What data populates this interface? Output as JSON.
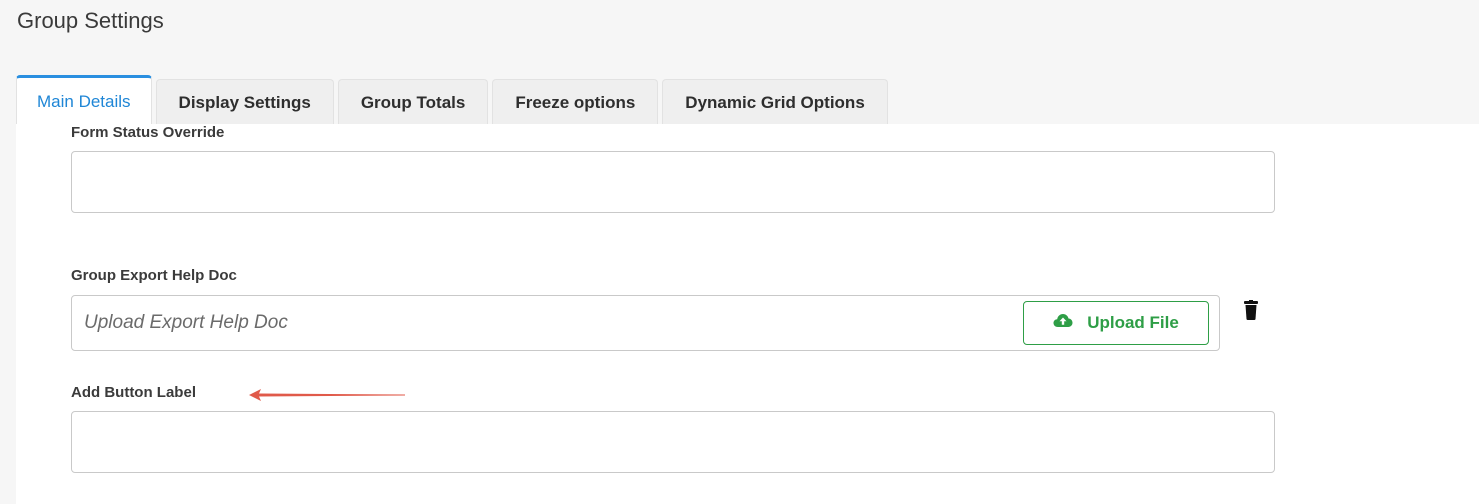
{
  "header": {
    "title": "Group Settings"
  },
  "tabs": [
    {
      "label": "Main Details",
      "active": true
    },
    {
      "label": "Display Settings",
      "active": false
    },
    {
      "label": "Group Totals",
      "active": false
    },
    {
      "label": "Freeze options",
      "active": false
    },
    {
      "label": "Dynamic Grid Options",
      "active": false
    }
  ],
  "form": {
    "form_status_override": {
      "label": "Form Status Override",
      "value": ""
    },
    "group_export_help_doc": {
      "label": "Group Export Help Doc",
      "placeholder": "Upload Export Help Doc",
      "upload_label": "Upload File",
      "upload_icon": "cloud-upload-icon",
      "delete_icon": "trash-icon"
    },
    "add_button_label": {
      "label": "Add Button Label",
      "value": ""
    }
  },
  "annotation": {
    "icon": "red-arrow-icon",
    "color": "#e05a4a"
  },
  "colors": {
    "accent": "#2a8fe0",
    "success": "#2e9e46",
    "background": "#f6f6f6"
  }
}
